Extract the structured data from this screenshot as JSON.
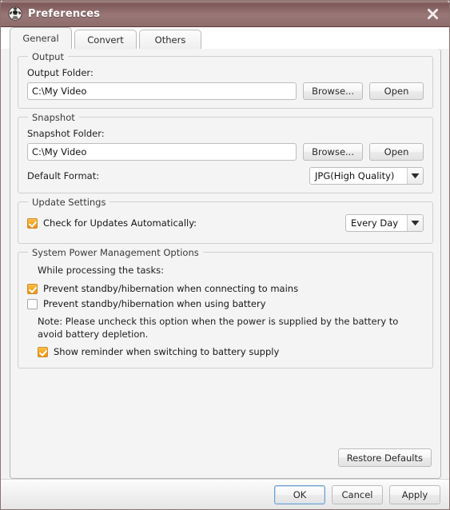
{
  "window": {
    "title": "Preferences",
    "icon": "soccer-ball-icon",
    "close_label": "✕",
    "titlebar_color": "#8e6c6c"
  },
  "tabs": [
    {
      "label": "General",
      "active": true
    },
    {
      "label": "Convert",
      "active": false
    },
    {
      "label": "Others",
      "active": false
    }
  ],
  "output": {
    "legend": "Output",
    "folder_label": "Output Folder:",
    "folder_value": "C:\\My Video",
    "folder_placeholder": "Output folder path",
    "browse_label": "Browse...",
    "open_label": "Open"
  },
  "snapshot": {
    "legend": "Snapshot",
    "folder_label": "Snapshot Folder:",
    "folder_value": "C:\\My Video",
    "folder_placeholder": "Snapshot folder path",
    "browse_label": "Browse...",
    "open_label": "Open",
    "format_label": "Default Format:",
    "format_value": "JPG(High Quality)"
  },
  "update": {
    "legend": "Update Settings",
    "check_label": "Check for Updates Automatically:",
    "check_checked": true,
    "frequency_value": "Every Day"
  },
  "power": {
    "legend": "System Power Management Options",
    "intro": "While processing the tasks:",
    "mains_label": "Prevent standby/hibernation when connecting to mains",
    "mains_checked": true,
    "battery_label": "Prevent standby/hibernation when using battery",
    "battery_checked": false,
    "note": "Note: Please uncheck this option when the power is supplied by the battery to avoid battery depletion.",
    "reminder_label": "Show reminder when switching to battery supply",
    "reminder_checked": true
  },
  "actions": {
    "restore_label": "Restore Defaults",
    "ok_label": "OK",
    "cancel_label": "Cancel",
    "apply_label": "Apply"
  },
  "colors": {
    "accent_checkbox": "#f5a623",
    "titlebar": "#8e6c6c",
    "focus_blue": "#6f9fd0"
  }
}
